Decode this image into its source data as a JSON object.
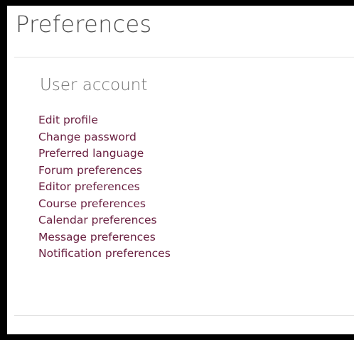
{
  "page": {
    "title": "Preferences"
  },
  "section": {
    "heading": "User account",
    "links": [
      "Edit profile",
      "Change password",
      "Preferred language",
      "Forum preferences",
      "Editor preferences",
      "Course preferences",
      "Calendar preferences",
      "Message preferences",
      "Notification preferences"
    ]
  },
  "colors": {
    "link": "#6a2041",
    "title_text": "#4a4a4a",
    "heading_text": "#6e6e6e",
    "border": "#000000",
    "divider": "#e2e2e2"
  }
}
